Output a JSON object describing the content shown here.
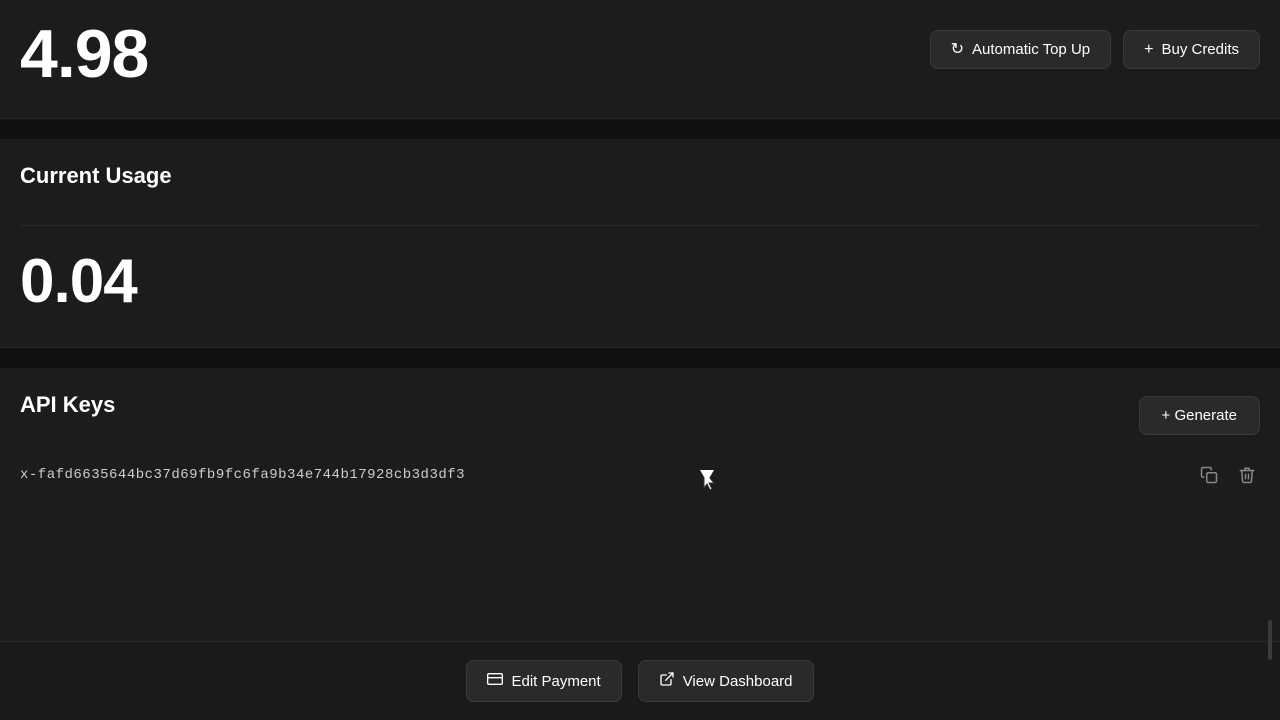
{
  "balance": {
    "amount": "4.98",
    "prefix": "$"
  },
  "buttons": {
    "automatic_top_up": "Automatic Top Up",
    "buy_credits": "Buy Credits"
  },
  "usage": {
    "title": "Current Usage",
    "amount": "0.04"
  },
  "api_keys": {
    "title": "API Keys",
    "generate_label": "+ Generate",
    "key_value": "x-fafd6635644bc37d69fb9fc6fa9b34e744b17928cb3d3df3"
  },
  "footer": {
    "edit_payment": "Edit Payment",
    "view_dashboard": "View Dashboard"
  },
  "icons": {
    "refresh": "↻",
    "plus": "+",
    "copy": "⧉",
    "trash": "🗑",
    "card": "💳",
    "external": "⬚"
  }
}
